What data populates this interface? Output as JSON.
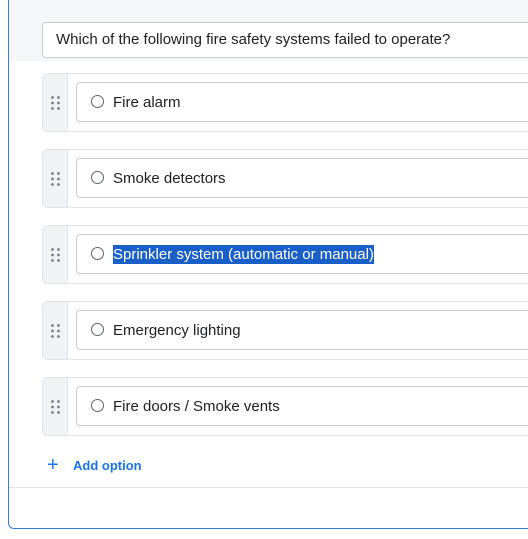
{
  "question": {
    "text": "Which of the following fire safety systems failed to operate?"
  },
  "options": [
    {
      "label": "Fire alarm",
      "selected_text": false
    },
    {
      "label": "Smoke detectors",
      "selected_text": false
    },
    {
      "label": "Sprinkler system (automatic or manual)",
      "selected_text": true
    },
    {
      "label": "Emergency lighting",
      "selected_text": false
    },
    {
      "label": "Fire doors / Smoke vents",
      "selected_text": false
    }
  ],
  "add_option": {
    "label": "Add option",
    "icon": "plus-icon"
  },
  "colors": {
    "card_border": "#3a7bd5",
    "accent": "#1a73e8",
    "selection": "#1a5fc8"
  }
}
